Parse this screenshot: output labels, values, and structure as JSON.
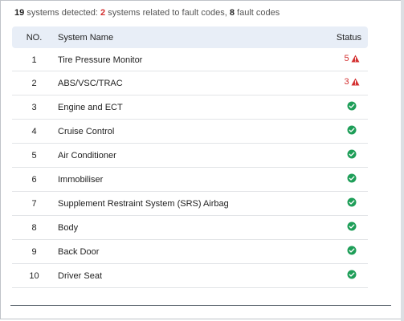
{
  "summary": {
    "systems_count": "19",
    "systems_text": "systems detected:",
    "fault_systems_count": "2",
    "fault_systems_text": "systems related to fault codes,",
    "fault_codes_count": "8",
    "fault_codes_text": "fault codes"
  },
  "table": {
    "headers": {
      "no": "NO.",
      "name": "System Name",
      "status": "Status"
    },
    "rows": [
      {
        "no": "1",
        "name": "Tire Pressure Monitor",
        "status": "fault",
        "faults": "5"
      },
      {
        "no": "2",
        "name": "ABS/VSC/TRAC",
        "status": "fault",
        "faults": "3"
      },
      {
        "no": "3",
        "name": "Engine and ECT",
        "status": "ok"
      },
      {
        "no": "4",
        "name": "Cruise Control",
        "status": "ok"
      },
      {
        "no": "5",
        "name": "Air Conditioner",
        "status": "ok"
      },
      {
        "no": "6",
        "name": "Immobiliser",
        "status": "ok"
      },
      {
        "no": "7",
        "name": "Supplement Restraint System (SRS) Airbag",
        "status": "ok"
      },
      {
        "no": "8",
        "name": "Body",
        "status": "ok"
      },
      {
        "no": "9",
        "name": "Back Door",
        "status": "ok"
      },
      {
        "no": "10",
        "name": "Driver Seat",
        "status": "ok"
      }
    ]
  },
  "icons": {
    "ok": "check-circle-icon",
    "fault": "warning-triangle-icon"
  },
  "colors": {
    "ok": "#1e9e58",
    "fault": "#d32f2f",
    "header_bg": "#e8eef7"
  }
}
